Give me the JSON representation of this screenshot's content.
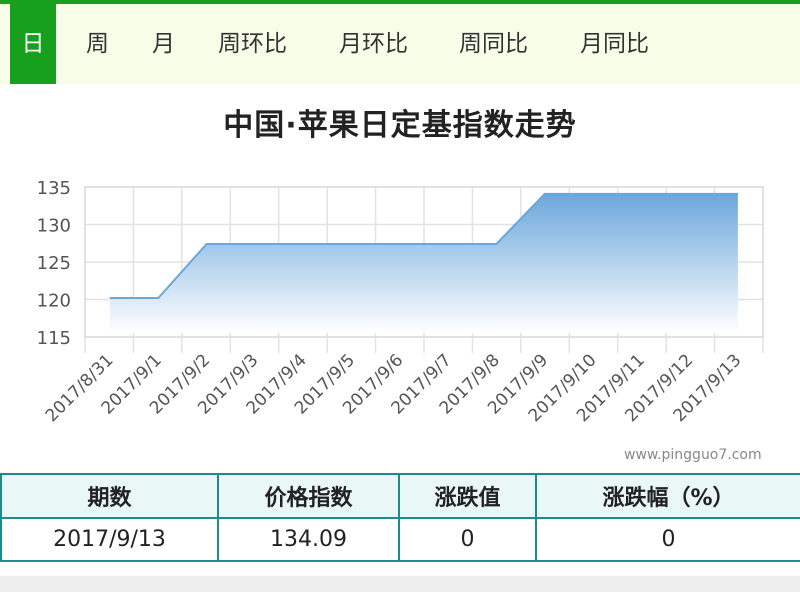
{
  "tabs": [
    {
      "label": "日",
      "active": true
    },
    {
      "label": "周",
      "active": false
    },
    {
      "label": "月",
      "active": false
    },
    {
      "label": "周环比",
      "active": false
    },
    {
      "label": "月环比",
      "active": false
    },
    {
      "label": "周同比",
      "active": false
    },
    {
      "label": "月同比",
      "active": false
    }
  ],
  "colors": {
    "accent": "#16a01e",
    "tab_bg": "#f8fde8",
    "series": "#6ba7dc",
    "table_border": "#1e8a8a"
  },
  "watermark": "www.pingguo7.com",
  "chart_data": {
    "type": "area",
    "title": "中国·苹果日定基指数走势",
    "xlabel": "",
    "ylabel": "",
    "categories": [
      "2017/8/31",
      "2017/9/1",
      "2017/9/2",
      "2017/9/3",
      "2017/9/4",
      "2017/9/5",
      "2017/9/6",
      "2017/9/7",
      "2017/9/8",
      "2017/9/9",
      "2017/9/10",
      "2017/9/11",
      "2017/9/12",
      "2017/9/13"
    ],
    "values": [
      120.2,
      120.2,
      127.4,
      127.4,
      127.4,
      127.4,
      127.4,
      127.4,
      127.4,
      134.09,
      134.09,
      134.09,
      134.09,
      134.09
    ],
    "yticks": [
      115,
      120,
      125,
      130,
      135
    ],
    "ylim": [
      115,
      135
    ],
    "grid": true
  },
  "table": {
    "headers": [
      "期数",
      "价格指数",
      "涨跌值",
      "涨跌幅（%）"
    ],
    "rows": [
      [
        "2017/9/13",
        "134.09",
        "0",
        "0"
      ]
    ]
  }
}
